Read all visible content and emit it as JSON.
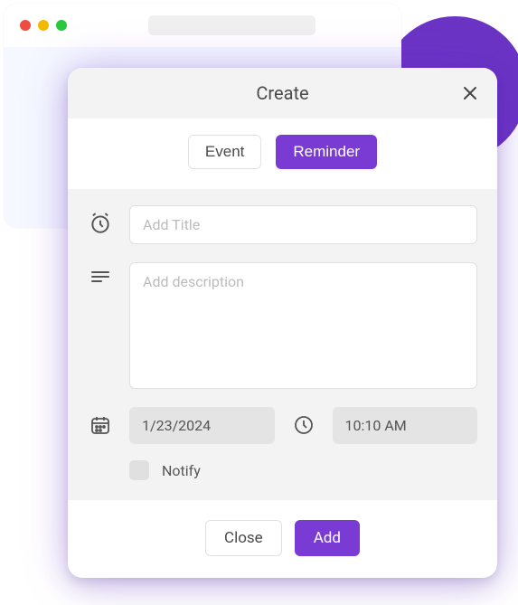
{
  "modal": {
    "title": "Create",
    "tabs": {
      "event": "Event",
      "reminder": "Reminder"
    },
    "fields": {
      "title_placeholder": "Add Title",
      "description_placeholder": "Add description",
      "date_value": "1/23/2024",
      "time_value": "10:10 AM",
      "notify_label": "Notify"
    },
    "footer": {
      "close": "Close",
      "add": "Add"
    }
  }
}
